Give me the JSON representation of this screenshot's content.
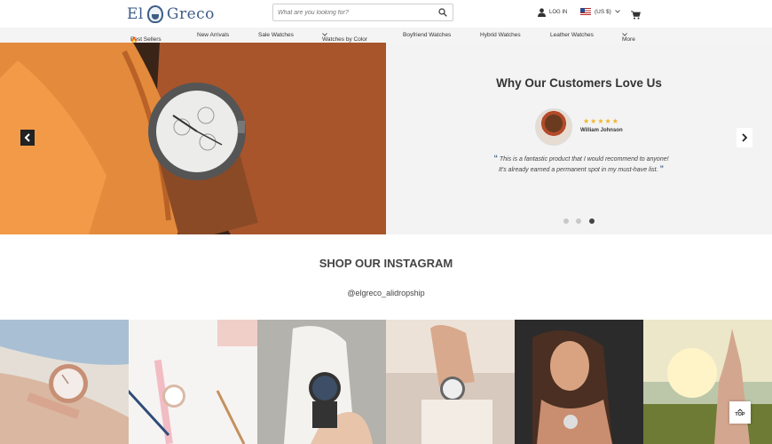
{
  "header": {
    "logo_left": "El",
    "logo_right": "Greco",
    "search_placeholder": "What are you looking for?",
    "login_label": "LOG IN",
    "currency_label": "(US $)"
  },
  "nav": {
    "items": [
      "Best Sellers",
      "New Arrivals",
      "Sale Watches",
      "Watches by Color",
      "Boyfriend Watches",
      "Hybrid Watches",
      "Leather Watches",
      "More"
    ]
  },
  "testimonial": {
    "heading": "Why Our Customers Love Us",
    "rating": 5,
    "stars": "★★★★★",
    "reviewer": "William Johnson",
    "quote_line1": "This is a fantastic product that I would recommend to anyone!",
    "quote_line2": "It's already earned a permanent spot in my must-have list.",
    "active_slide": 3,
    "slide_count": 3
  },
  "instagram": {
    "title": "SHOP OUR INSTAGRAM",
    "handle": "@elgreco_alidropship"
  },
  "back_to_top": "TOP",
  "colors": {
    "brand": "#3d5d86",
    "star": "#f0b429",
    "nav_bg": "#f4f4f4",
    "testimonial_bg": "#f3f3f3"
  }
}
